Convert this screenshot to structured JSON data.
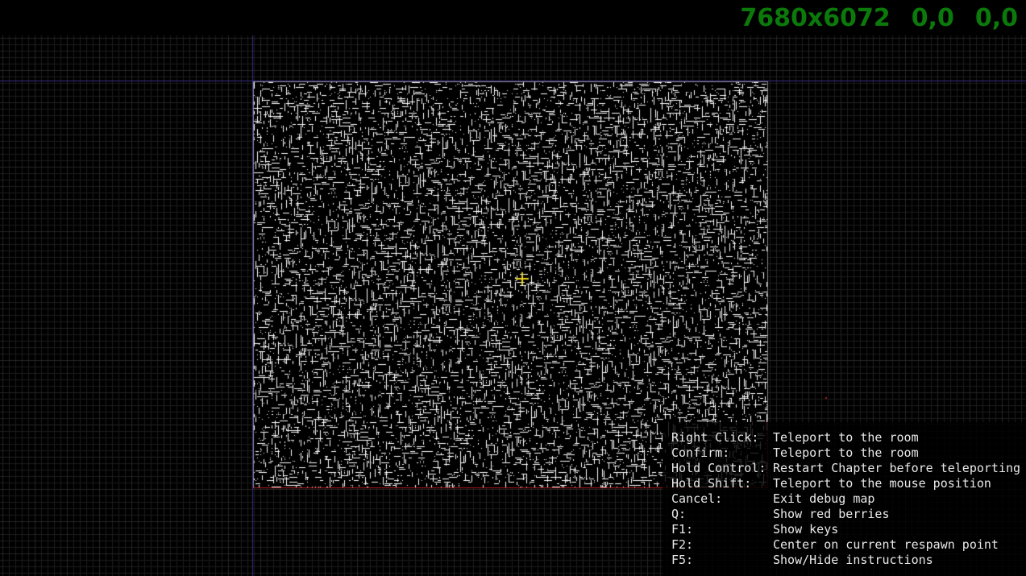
{
  "hud": {
    "map_size": "7680x6072",
    "coord_a": "0,0",
    "coord_b": "0,0",
    "color": "#0b7a0b"
  },
  "map": {
    "background_color": "#000000",
    "grid_color": "#1c1c1c",
    "axis_color": "#3a2f8a",
    "room_fill_color": "#ffffff",
    "room_border_color": "#b01818",
    "cursor_color": "#e8d21a",
    "cursor_icon": "crosshair-icon"
  },
  "instructions": [
    {
      "key": "Right Click:",
      "action": "Teleport to the room"
    },
    {
      "key": "Confirm:",
      "action": "Teleport to the room"
    },
    {
      "key": "Hold Control:",
      "action": "Restart Chapter before teleporting"
    },
    {
      "key": "Hold Shift:",
      "action": "Teleport to the mouse position"
    },
    {
      "key": "Cancel:",
      "action": "Exit debug map"
    },
    {
      "key": "Q:",
      "action": "Show red berries"
    },
    {
      "key": "F1:",
      "action": "Show keys"
    },
    {
      "key": "F2:",
      "action": "Center on current respawn point"
    },
    {
      "key": "F5:",
      "action": "Show/Hide instructions"
    }
  ]
}
